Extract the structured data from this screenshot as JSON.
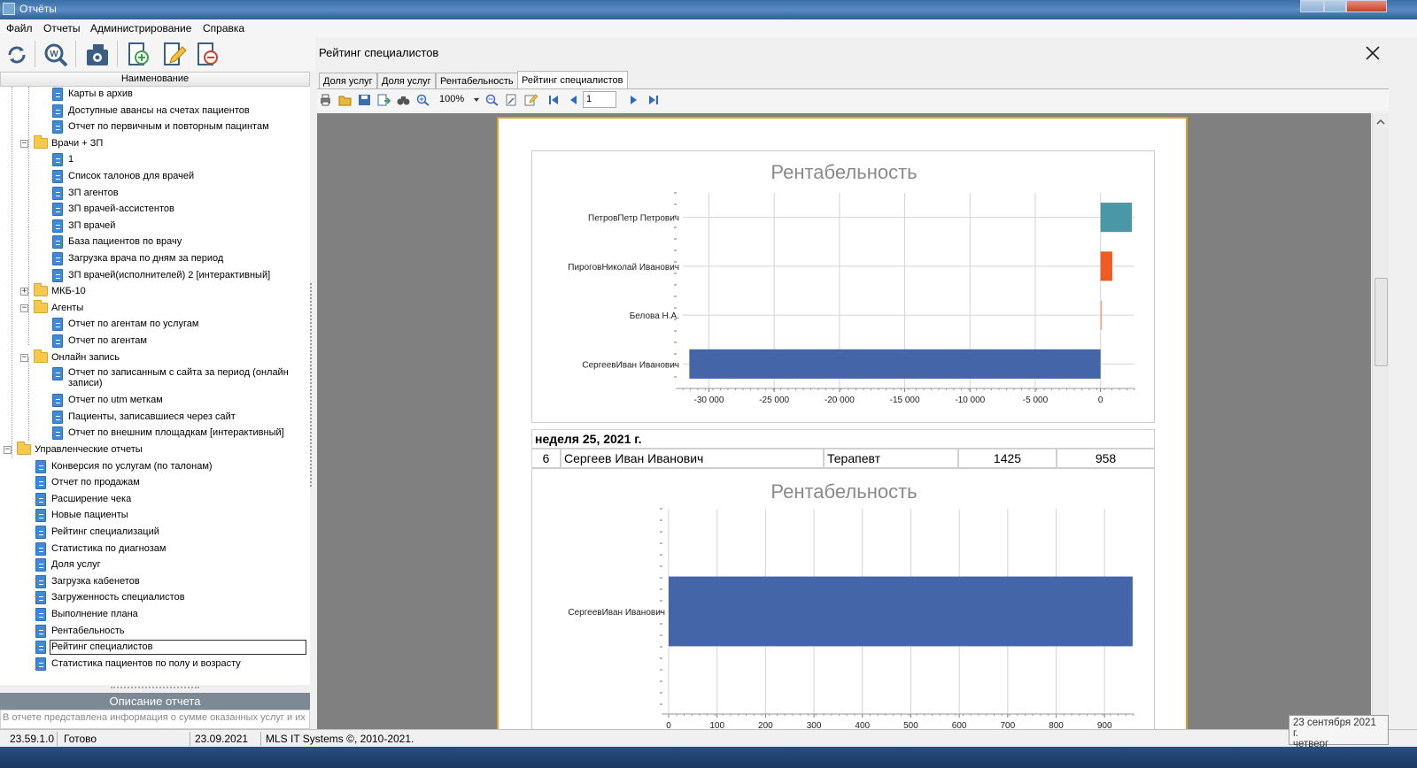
{
  "window": {
    "title": "Отчёты"
  },
  "menu": [
    "Файл",
    "Отчеты",
    "Администрирование",
    "Справка"
  ],
  "toolbar": [
    {
      "name": "refresh-icon"
    },
    {
      "name": "search-report-icon"
    },
    {
      "name": "camera-icon"
    },
    {
      "name": "add-report-icon"
    },
    {
      "name": "edit-report-icon"
    },
    {
      "name": "delete-report-icon"
    }
  ],
  "tree": {
    "header": "Наименование",
    "items": [
      {
        "label": "Карты в архив",
        "type": "doc",
        "level": 2
      },
      {
        "label": "Доступные авансы на счетах пациентов",
        "type": "doc",
        "level": 2
      },
      {
        "label": "Отчет по первичным и повторным пацинтам",
        "type": "doc",
        "level": 2
      },
      {
        "label": "Врачи + ЗП",
        "type": "folder",
        "level": 1,
        "state": "expanded"
      },
      {
        "label": "1",
        "type": "doc",
        "level": 2
      },
      {
        "label": "Список талонов для врачей",
        "type": "doc",
        "level": 2
      },
      {
        "label": "ЗП агентов",
        "type": "doc",
        "level": 2
      },
      {
        "label": "ЗП врачей-ассистентов",
        "type": "doc",
        "level": 2
      },
      {
        "label": "ЗП врачей",
        "type": "doc",
        "level": 2
      },
      {
        "label": "База пациентов по врачу",
        "type": "doc",
        "level": 2
      },
      {
        "label": "Загрузка врача по дням за период",
        "type": "doc",
        "level": 2
      },
      {
        "label": "ЗП врачей(исполнителей) 2 [интерактивный]",
        "type": "doc",
        "level": 2
      },
      {
        "label": "МКБ-10",
        "type": "folder",
        "level": 1,
        "state": "collapsed"
      },
      {
        "label": "Агенты",
        "type": "folder",
        "level": 1,
        "state": "expanded"
      },
      {
        "label": "Отчет по агентам по услугам",
        "type": "doc",
        "level": 2
      },
      {
        "label": "Отчет по агентам",
        "type": "doc",
        "level": 2
      },
      {
        "label": "Онлайн запись",
        "type": "folder",
        "level": 1,
        "state": "expanded"
      },
      {
        "label": "Отчет по записанным с сайта за период (онлайн записи)",
        "type": "doc",
        "level": 2,
        "wrap": true
      },
      {
        "label": "Отчет по utm меткам",
        "type": "doc",
        "level": 2
      },
      {
        "label": "Пациенты, записавшиеся через сайт",
        "type": "doc",
        "level": 2
      },
      {
        "label": "Отчет по внешним площадкам [интерактивный]",
        "type": "doc",
        "level": 2
      },
      {
        "label": "Управленческие отчеты",
        "type": "folder",
        "level": 0,
        "state": "expanded"
      },
      {
        "label": "Конверсия по услугам (по талонам)",
        "type": "doc",
        "level": 1
      },
      {
        "label": "Отчет по продажам",
        "type": "doc",
        "level": 1
      },
      {
        "label": "Расширение чека",
        "type": "doc",
        "level": 1
      },
      {
        "label": "Новые пациенты",
        "type": "doc",
        "level": 1
      },
      {
        "label": "Рейтинг специализаций",
        "type": "doc",
        "level": 1
      },
      {
        "label": "Статистика по диагнозам",
        "type": "doc",
        "level": 1
      },
      {
        "label": "Доля услуг",
        "type": "doc",
        "level": 1
      },
      {
        "label": "Загрузка кабенетов",
        "type": "doc",
        "level": 1
      },
      {
        "label": "Загруженность специалистов",
        "type": "doc",
        "level": 1
      },
      {
        "label": "Выполнение плана",
        "type": "doc",
        "level": 1
      },
      {
        "label": "Рентабельность",
        "type": "doc",
        "level": 1
      },
      {
        "label": "Рейтинг специалистов",
        "type": "doc",
        "level": 1,
        "selected": true
      },
      {
        "label": "Статистика пациентов по полу и возрасту",
        "type": "doc",
        "level": 1
      }
    ]
  },
  "description": {
    "header": "Описание отчета",
    "text": "В отчете представлена информация о сумме оказанных услуг и их"
  },
  "report": {
    "title": "Рейтинг специалистов",
    "tabs": [
      "Доля услуг",
      "Доля услуг",
      "Рентабельность",
      "Рейтинг специалистов"
    ],
    "active_tab": 3,
    "zoom": "100%",
    "page": "1",
    "week_label": "неделя 25, 2021 г.",
    "row": {
      "num": "6",
      "name": "Сергеев Иван Иванович",
      "spec": "Терапевт",
      "v1": "1425",
      "v2": "958"
    }
  },
  "chart_data": [
    {
      "type": "bar",
      "orientation": "horizontal",
      "title": "Рентабельность",
      "categories": [
        "ПетровПетр Петрович",
        "ПироговНиколай Иванович",
        "Белова Н.А.",
        "СергеевИван Иванович"
      ],
      "values": [
        2400,
        900,
        100,
        -31500
      ],
      "colors": [
        "#4a97a8",
        "#f05a23",
        "#f1a57c",
        "#4466a8"
      ],
      "xlim": [
        -32000,
        2600
      ],
      "ticks": [
        -30000,
        -25000,
        -20000,
        -15000,
        -10000,
        -5000,
        0
      ],
      "tick_labels": [
        "-30 000",
        "-25 000",
        "-20 000",
        "-15 000",
        "-10 000",
        "-5 000",
        "0"
      ],
      "grid": true
    },
    {
      "type": "bar",
      "orientation": "horizontal",
      "title": "Рентабельность",
      "categories": [
        "СергеевИван Иванович"
      ],
      "values": [
        958
      ],
      "colors": [
        "#4466a8"
      ],
      "xlim": [
        0,
        960
      ],
      "ticks": [
        0,
        100,
        200,
        300,
        400,
        500,
        600,
        700,
        800,
        900
      ],
      "tick_labels": [
        "0",
        "100",
        "200",
        "300",
        "400",
        "500",
        "600",
        "700",
        "800",
        "900"
      ],
      "grid": true
    }
  ],
  "status": {
    "version": "23.59.1.0",
    "state": "Готово",
    "date": "23.09.2021",
    "copyright": "MLS IT Systems ©, 2010-2021.",
    "datetime_tip_date": "23 сентября 2021 г.",
    "datetime_tip_day": "четверг"
  }
}
